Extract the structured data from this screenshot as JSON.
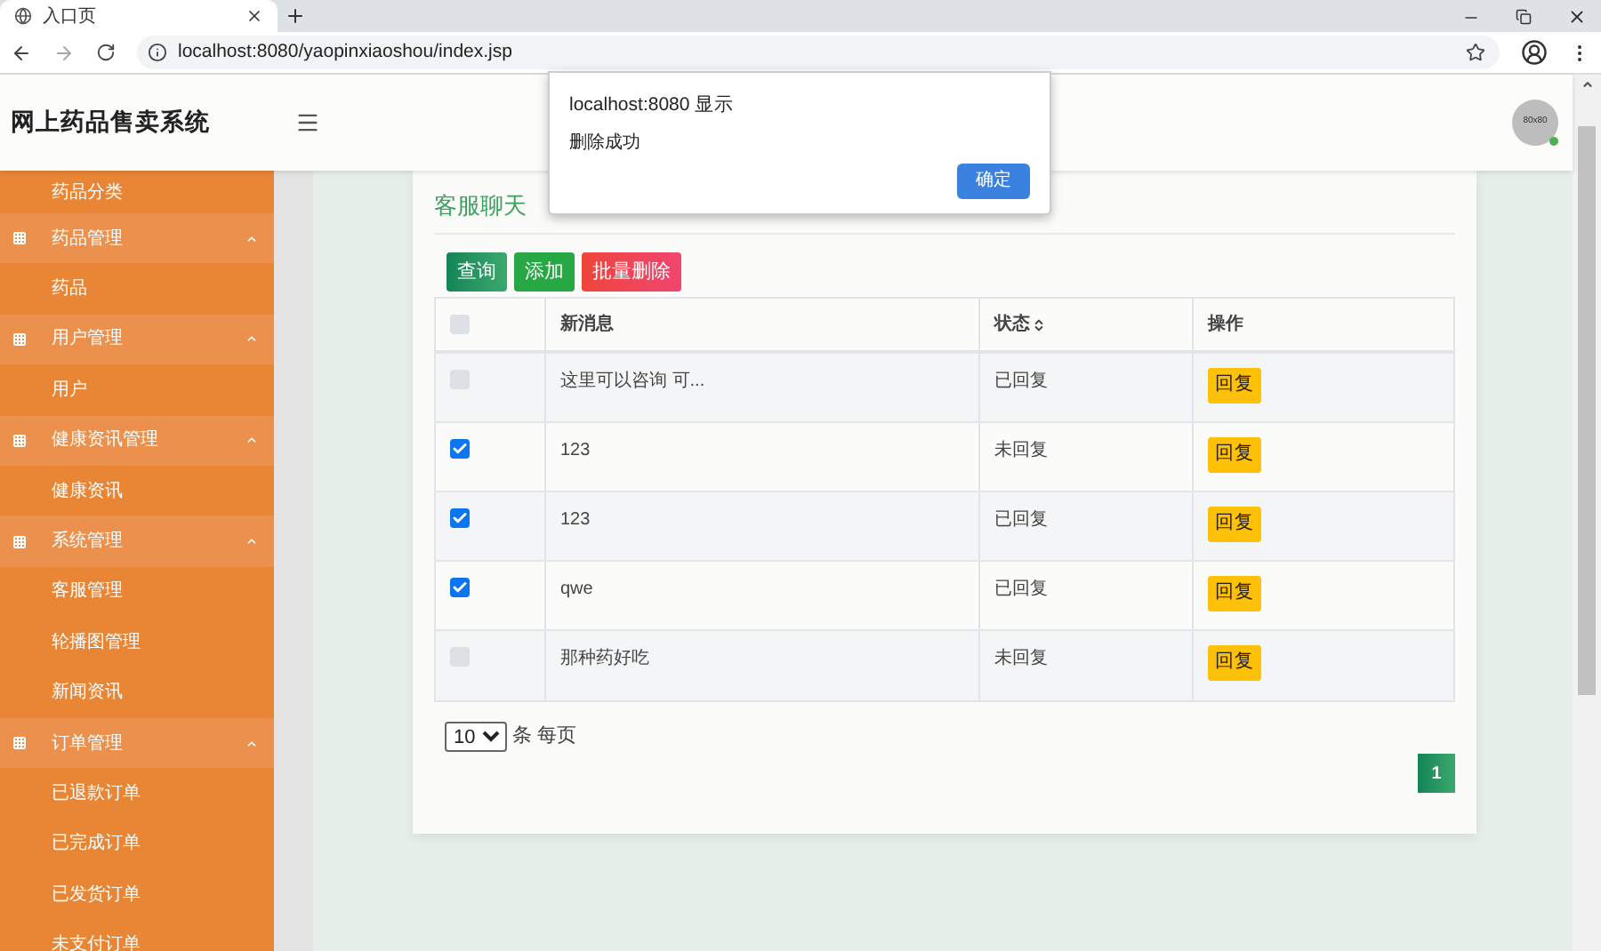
{
  "browser": {
    "tab_title": "入口页",
    "url": "localhost:8080/yaopinxiaoshou/index.jsp"
  },
  "header": {
    "title": "网上药品售卖系统",
    "avatar_text": "80x80"
  },
  "sidebar": {
    "items": [
      {
        "kind": "link",
        "label": "药品分类"
      },
      {
        "kind": "group",
        "label": "药品管理",
        "expanded": true,
        "children": [
          {
            "label": "药品"
          }
        ]
      },
      {
        "kind": "group",
        "label": "用户管理",
        "expanded": true,
        "children": [
          {
            "label": "用户"
          }
        ]
      },
      {
        "kind": "group",
        "label": "健康资讯管理",
        "expanded": true,
        "children": [
          {
            "label": "健康资讯"
          }
        ]
      },
      {
        "kind": "group",
        "label": "系统管理",
        "expanded": true,
        "children": [
          {
            "label": "客服管理"
          },
          {
            "label": "轮播图管理"
          },
          {
            "label": "新闻资讯"
          }
        ]
      },
      {
        "kind": "group",
        "label": "订单管理",
        "expanded": true,
        "children": [
          {
            "label": "已退款订单"
          },
          {
            "label": "已完成订单"
          },
          {
            "label": "已发货订单"
          },
          {
            "label": "未支付订单"
          }
        ]
      }
    ]
  },
  "card": {
    "title": "客服聊天",
    "buttons": [
      {
        "kind": "query",
        "label": "查询"
      },
      {
        "kind": "add",
        "label": "添加"
      },
      {
        "kind": "delete",
        "label": "批量删除"
      }
    ],
    "table": {
      "select_all_checked": false,
      "columns": [
        "新消息",
        "状态",
        "操作"
      ],
      "rows": [
        {
          "checked": false,
          "message": "这里可以咨询 可...",
          "status": "已回复",
          "action": "回复"
        },
        {
          "checked": true,
          "message": "123",
          "status": "未回复",
          "action": "回复"
        },
        {
          "checked": true,
          "message": "123",
          "status": "已回复",
          "action": "回复"
        },
        {
          "checked": true,
          "message": "qwe",
          "status": "已回复",
          "action": "回复"
        },
        {
          "checked": false,
          "message": "那种药好吃",
          "status": "未回复",
          "action": "回复"
        }
      ]
    },
    "pagination": {
      "page_size": "10",
      "page_size_label": "条 每页",
      "pages": [
        {
          "label": "1",
          "selected": true
        }
      ]
    }
  },
  "dialog": {
    "title": "localhost:8080 显示",
    "message": "删除成功",
    "ok": "确定"
  }
}
